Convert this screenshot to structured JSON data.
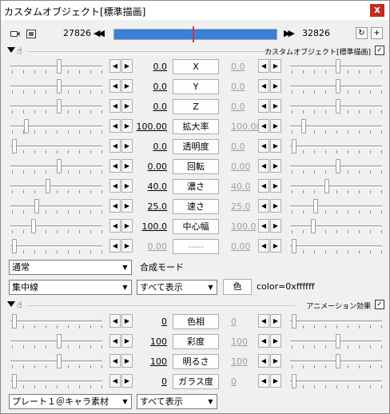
{
  "window": {
    "title": "カスタムオブジェクト[標準描画]",
    "close_label": "x"
  },
  "timeline": {
    "start_frame": "27826",
    "end_frame": "32826",
    "prev_label": "◀◀",
    "next_label": "▶▶"
  },
  "section1": {
    "label": "カスタムオブジェクト[標準描画]",
    "checked": "✓"
  },
  "params": [
    {
      "name": "X",
      "start": "0.0",
      "end": "0.0"
    },
    {
      "name": "Y",
      "start": "0.0",
      "end": "0.0"
    },
    {
      "name": "Z",
      "start": "0.0",
      "end": "0.0"
    },
    {
      "name": "拡大率",
      "start": "100.00",
      "end": "100.00"
    },
    {
      "name": "透明度",
      "start": "0.0",
      "end": "0.0"
    },
    {
      "name": "回転",
      "start": "0.00",
      "end": "0.00"
    },
    {
      "name": "濃さ",
      "start": "40.0",
      "end": "40.0"
    },
    {
      "name": "速さ",
      "start": "25.0",
      "end": "25.0"
    },
    {
      "name": "中心幅",
      "start": "100.0",
      "end": "100.0"
    },
    {
      "name": "-----",
      "start": "0.00",
      "end": "0.00"
    }
  ],
  "blend": {
    "value": "通常",
    "label": "合成モード"
  },
  "custom": {
    "type": "集中線",
    "display": "すべて表示",
    "color_button": "色",
    "color_value": "color=0xffffff"
  },
  "section2": {
    "label": "アニメーション効果",
    "checked": "✓"
  },
  "anim_params": [
    {
      "name": "色相",
      "start": "0",
      "end": "0"
    },
    {
      "name": "彩度",
      "start": "100",
      "end": "100"
    },
    {
      "name": "明るさ",
      "start": "100",
      "end": "100"
    },
    {
      "name": "ガラス度",
      "start": "0",
      "end": "0"
    }
  ],
  "anim": {
    "preset": "プレート１＠キャラ素材",
    "display": "すべて表示"
  }
}
